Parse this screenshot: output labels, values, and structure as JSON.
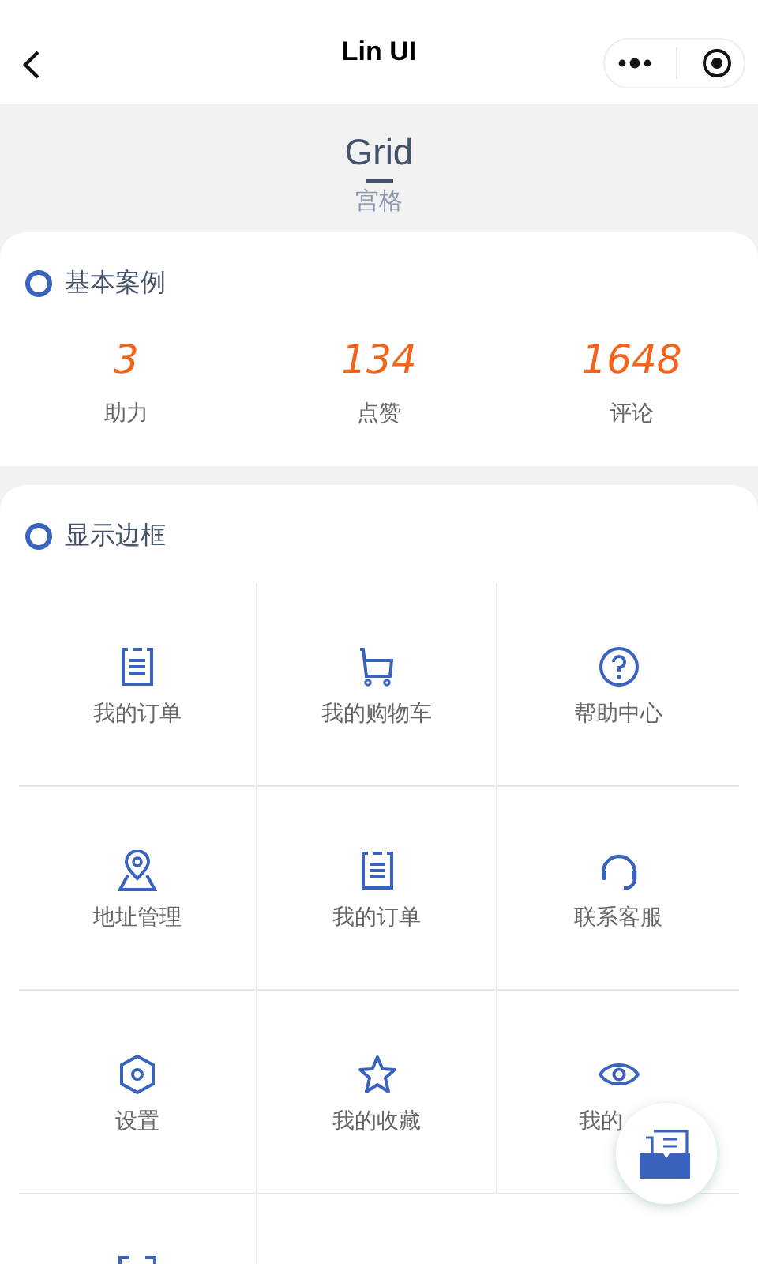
{
  "nav": {
    "title": "Lin UI"
  },
  "header": {
    "title": "Grid",
    "subtitle": "宫格"
  },
  "basic": {
    "title": "基本案例",
    "stats": [
      {
        "value": "3",
        "label": "助力"
      },
      {
        "value": "134",
        "label": "点赞"
      },
      {
        "value": "1648",
        "label": "评论"
      }
    ]
  },
  "bordered": {
    "title": "显示边框",
    "cells": [
      {
        "kind": "order",
        "label": "我的订单"
      },
      {
        "kind": "cart",
        "label": "我的购物车"
      },
      {
        "kind": "help",
        "label": "帮助中心"
      },
      {
        "kind": "location",
        "label": "地址管理"
      },
      {
        "kind": "order",
        "label": "我的订单"
      },
      {
        "kind": "headset",
        "label": "联系客服"
      },
      {
        "kind": "settings",
        "label": "设置"
      },
      {
        "kind": "star",
        "label": "我的收藏"
      },
      {
        "kind": "eye",
        "label": "我的"
      },
      {
        "kind": "scan"
      }
    ]
  }
}
